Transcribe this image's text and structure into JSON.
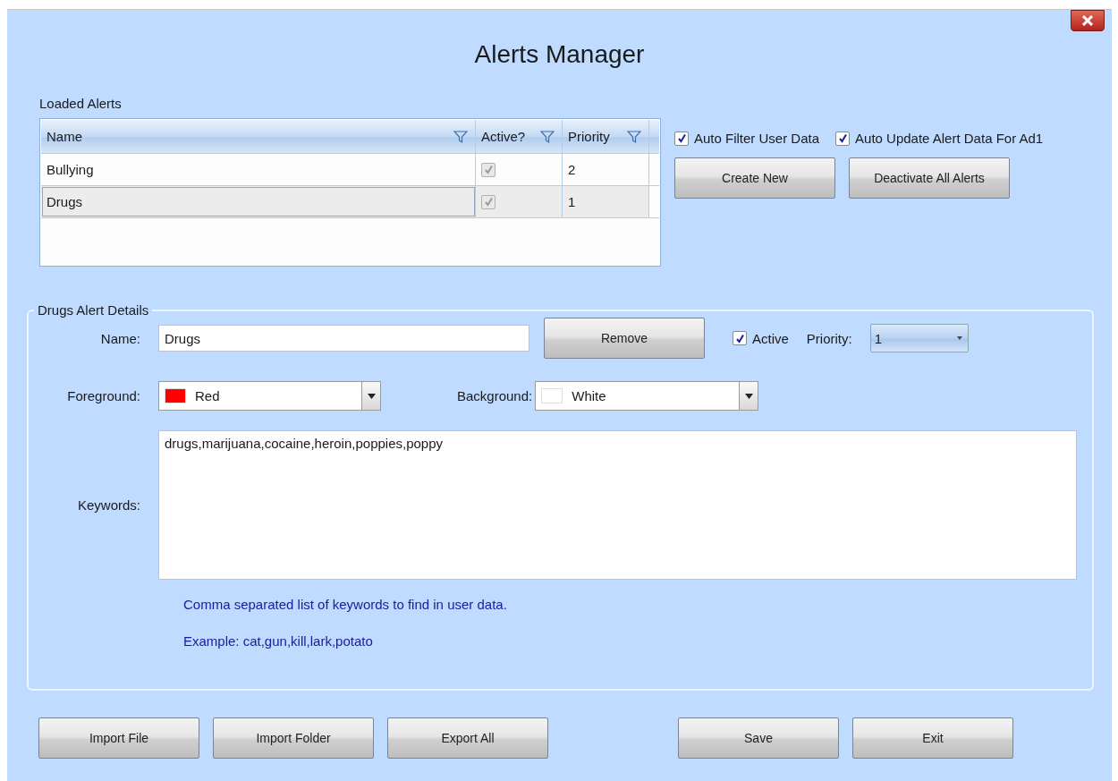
{
  "window": {
    "title": "Alerts Manager"
  },
  "loaded_alerts": {
    "label": "Loaded Alerts",
    "columns": [
      {
        "label": "Name"
      },
      {
        "label": "Active?"
      },
      {
        "label": "Priority"
      }
    ],
    "rows": [
      {
        "name": "Bullying",
        "active": true,
        "priority": "2",
        "selected": false
      },
      {
        "name": "Drugs",
        "active": true,
        "priority": "1",
        "selected": true
      }
    ]
  },
  "options": [
    {
      "label": "Auto Filter User Data",
      "checked": true
    },
    {
      "label": "Auto Update Alert Data For Ad1",
      "checked": true
    }
  ],
  "actions": [
    "Create New",
    "Deactivate All Alerts"
  ],
  "details": {
    "title": "Drugs Alert Details",
    "name_label": "Name:",
    "name_value": "Drugs",
    "remove_button": "Remove",
    "active": {
      "label": "Active",
      "checked": true
    },
    "priority_label": "Priority:",
    "priority_value": "1",
    "foreground_label": "Foreground:",
    "foreground": {
      "value": "Red",
      "color": "#ff0000"
    },
    "background_label": "Background:",
    "background": {
      "value": "White",
      "color": "#ffffff"
    },
    "keywords_label": "Keywords:",
    "keywords": "drugs,marijuana,cocaine,heroin,poppies,poppy",
    "hints": [
      "Comma separated list of keywords to find in user data.",
      "Example: cat,gun,kill,lark,potato"
    ]
  },
  "footer_left": [
    "Import File",
    "Import Folder",
    "Export All"
  ],
  "footer_right": [
    "Save",
    "Exit"
  ]
}
